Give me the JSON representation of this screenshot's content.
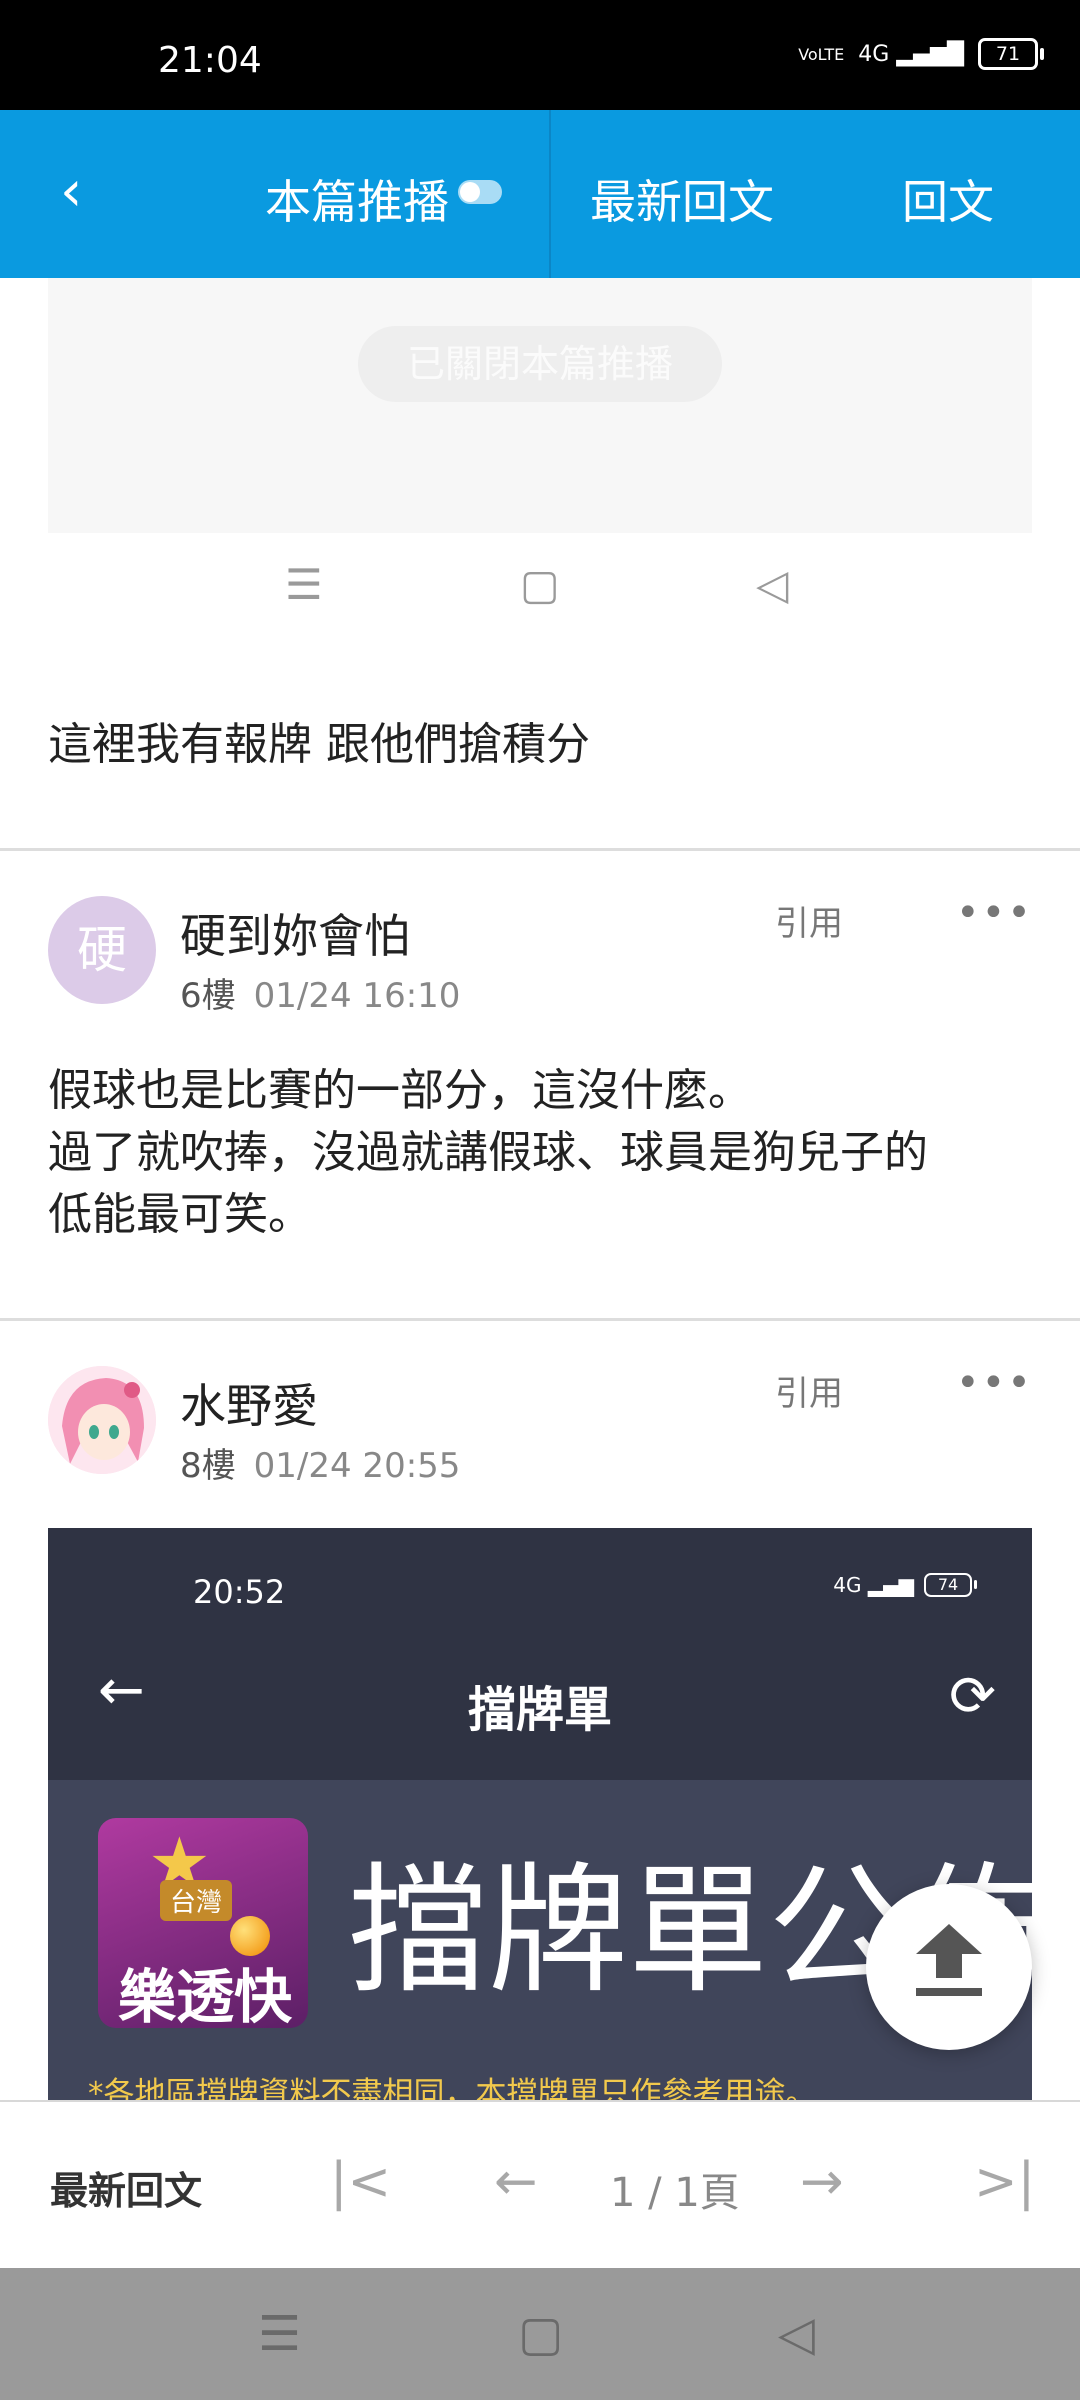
{
  "status_bar": {
    "time": "21:04",
    "volte": "VoLTE",
    "network": "4G",
    "battery": "71"
  },
  "top_bar": {
    "back": "‹",
    "push_tab": "本篇推播",
    "latest_tab": "最新回文",
    "reply_tab": "回文"
  },
  "push_box": {
    "closed_label": "已關閉本篇推播"
  },
  "ghost_nav": {
    "menu": "☰",
    "home": "▢",
    "back": "◁"
  },
  "posts": [
    {
      "body": "這裡我有報牌 跟他們搶積分"
    },
    {
      "avatar_letter": "硬",
      "username": "硬到妳會怕",
      "floor": "6樓",
      "datetime": "01/24 16:10",
      "quote_label": "引用",
      "more": "•••",
      "body": "假球也是比賽的一部分，這沒什麼。\n過了就吹捧，沒過就講假球、球員是狗兒子的\n低能最可笑。"
    },
    {
      "username": "水野愛",
      "floor": "8樓",
      "datetime": "01/24 20:55",
      "quote_label": "引用",
      "more": "•••"
    }
  ],
  "embedded_image": {
    "time": "20:52",
    "battery": "74",
    "network": "4G",
    "title": "擋牌單",
    "logo_badge": "台灣",
    "logo_brand": "樂透快",
    "headline": "擋牌單公佈",
    "notice": "*各地區擋牌資料不盡相同，本擋牌單只作參考用途。"
  },
  "pager": {
    "latest_label": "最新回文",
    "first": "|<",
    "prev": "←",
    "page_info": "1 / 1頁",
    "next": "→",
    "last": ">|"
  },
  "system_nav": {
    "menu": "☰",
    "home": "▢",
    "back": "◁"
  }
}
